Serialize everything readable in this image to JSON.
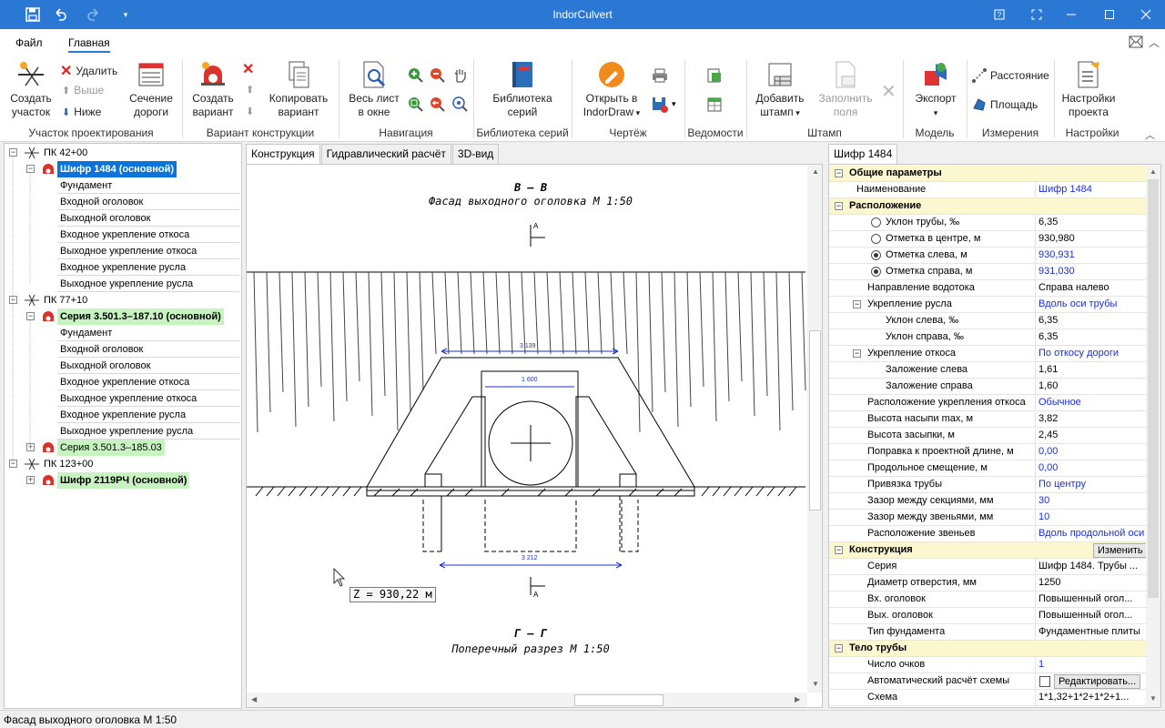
{
  "window": {
    "title": "IndorCulvert"
  },
  "menu": {
    "file": "Файл",
    "home": "Главная"
  },
  "ribbon": {
    "groups": {
      "site": "Участок проектирования",
      "variant": "Вариант конструкции",
      "navigation": "Навигация",
      "library": "Библиотека серий",
      "drawing": "Чертёж",
      "statements": "Ведомости",
      "stamp": "Штамп",
      "model": "Модель",
      "measure": "Измерения",
      "settings": "Настройки"
    },
    "buttons": {
      "create_site": "Создать участок",
      "delete": "Удалить",
      "up": "Выше",
      "down": "Ниже",
      "road_section": "Сечение дороги",
      "create_variant": "Создать вариант",
      "copy_variant": "Копировать вариант",
      "fit_sheet": "Весь лист в окне",
      "library": "Библиотека серий",
      "open_indordraw": "Открыть в IndorDraw",
      "add_stamp": "Добавить штамп",
      "fill_fields": "Заполнить поля",
      "export": "Экспорт",
      "distance": "Расстояние",
      "area": "Площадь",
      "project_settings": "Настройки проекта"
    }
  },
  "tree": {
    "items": [
      {
        "label": "ПК 42+00"
      },
      {
        "label": "Шифр 1484 (основной)"
      },
      {
        "label": "Фундамент"
      },
      {
        "label": "Входной оголовок"
      },
      {
        "label": "Выходной оголовок"
      },
      {
        "label": "Входное укрепление откоса"
      },
      {
        "label": "Выходное укрепление откоса"
      },
      {
        "label": "Входное укрепление русла"
      },
      {
        "label": "Выходное укрепление русла"
      },
      {
        "label": "ПК 77+10"
      },
      {
        "label": "Серия 3.501.3–187.10 (основной)"
      },
      {
        "label": "Фундамент"
      },
      {
        "label": "Входной оголовок"
      },
      {
        "label": "Выходной оголовок"
      },
      {
        "label": "Входное укрепление откоса"
      },
      {
        "label": "Выходное укрепление откоса"
      },
      {
        "label": "Входное укрепление русла"
      },
      {
        "label": "Выходное укрепление русла"
      },
      {
        "label": "Серия 3.501.3–185.03"
      },
      {
        "label": "ПК 123+00"
      },
      {
        "label": "Шифр 2119РЧ (основной)"
      }
    ]
  },
  "center_tabs": [
    "Конструкция",
    "Гидравлический расчёт",
    "3D-вид"
  ],
  "drawing": {
    "section1_title": "В – В",
    "section1_subtitle": "Фасад выходного оголовка М 1:50",
    "section2_title": "Г – Г",
    "section2_subtitle": "Поперечный разрез М 1:50",
    "marker_a": "А",
    "dim_top": "3 139",
    "dim_mid": "1 600",
    "dim_bottom": "3 212",
    "z_label": "Z = 930,22 м"
  },
  "right_tab": "Шифр 1484",
  "properties": {
    "cat_general": "Общие параметры",
    "name_label": "Наименование",
    "name_value": "Шифр 1484",
    "cat_location": "Расположение",
    "rows_location": [
      {
        "label": "Уклон трубы, ‰",
        "value": "6,35"
      },
      {
        "label": "Отметка в центре, м",
        "value": "930,980"
      },
      {
        "label": "Отметка слева, м",
        "value": "930,931"
      },
      {
        "label": "Отметка справа, м",
        "value": "931,030"
      },
      {
        "label": "Направление водотока",
        "value": "Справа налево"
      },
      {
        "label": "Укрепление русла",
        "value": "Вдоль оси трубы"
      },
      {
        "label": "Уклон слева, ‰",
        "value": "6,35"
      },
      {
        "label": "Уклон справа, ‰",
        "value": "6,35"
      },
      {
        "label": "Укрепление откоса",
        "value": "По откосу дороги"
      },
      {
        "label": "Заложение слева",
        "value": "1,61"
      },
      {
        "label": "Заложение справа",
        "value": "1,60"
      },
      {
        "label": "Расположение укрепления откоса",
        "value": "Обычное"
      },
      {
        "label": "Высота насыпи max, м",
        "value": "3,82"
      },
      {
        "label": "Высота засыпки, м",
        "value": "2,45"
      },
      {
        "label": "Поправка к проектной длине, м",
        "value": "0,00"
      },
      {
        "label": "Продольное смещение, м",
        "value": "0,00"
      },
      {
        "label": "Привязка трубы",
        "value": "По центру"
      },
      {
        "label": "Зазор между секциями, мм",
        "value": "30"
      },
      {
        "label": "Зазор между звеньями, мм",
        "value": "10"
      },
      {
        "label": "Расположение звеньев",
        "value": "Вдоль продольной оси"
      }
    ],
    "cat_construction": "Конструкция",
    "change_button": "Изменить",
    "rows_construction": [
      {
        "label": "Серия",
        "value": "Шифр 1484. Трубы ..."
      },
      {
        "label": "Диаметр отверстия, мм",
        "value": "1250"
      },
      {
        "label": "Вх. оголовок",
        "value": "Повышенный огол..."
      },
      {
        "label": "Вых. оголовок",
        "value": "Повышенный огол..."
      },
      {
        "label": "Тип фундамента",
        "value": "Фундаментные плиты"
      }
    ],
    "cat_body": "Тело трубы",
    "rows_body": [
      {
        "label": "Число очков",
        "value": "1"
      },
      {
        "label": "Автоматический расчёт схемы",
        "value": ""
      },
      {
        "label": "Схема",
        "value": "1*1,32+1*2+1*2+1..."
      }
    ],
    "edit_button": "Редактировать..."
  },
  "status": {
    "text": "Фасад выходного оголовка М 1:50"
  },
  "colors": {
    "accent": "#2b78d4",
    "selection": "#0a74da",
    "green_highlight": "#c7f3c0",
    "category_bg": "#fbf7cf",
    "value_blue": "#1a2fd6"
  }
}
